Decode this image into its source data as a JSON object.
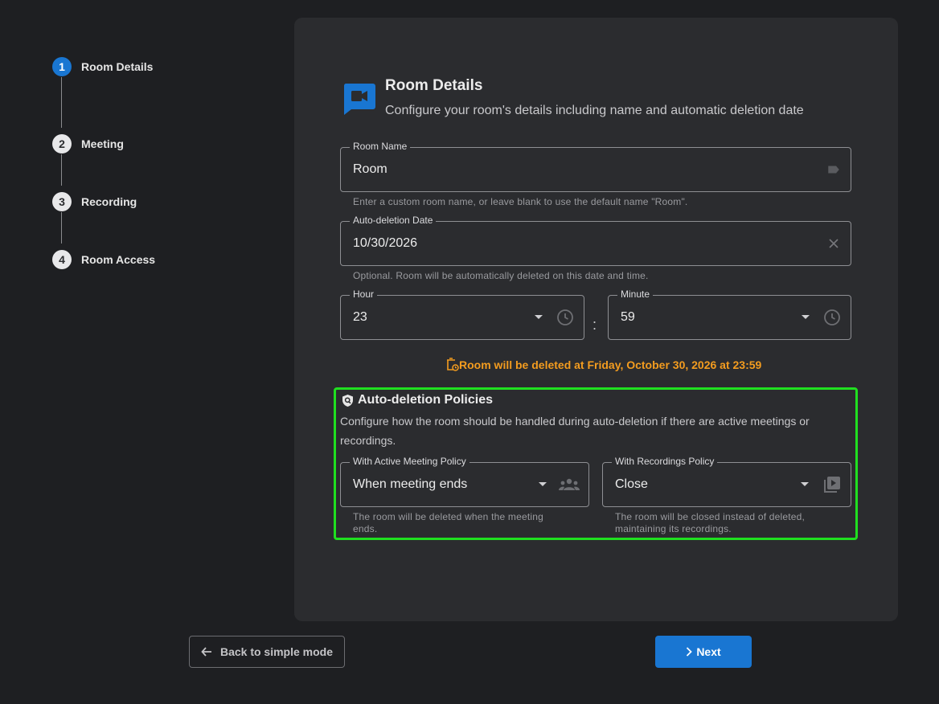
{
  "stepper": {
    "steps": [
      {
        "number": "1",
        "label": "Room Details"
      },
      {
        "number": "2",
        "label": "Meeting"
      },
      {
        "number": "3",
        "label": "Recording"
      },
      {
        "number": "4",
        "label": "Room Access"
      }
    ]
  },
  "header": {
    "icon": "videocam-chat-icon",
    "title": "Room Details",
    "subtitle": "Configure your room's details including name and automatic deletion date"
  },
  "room_name": {
    "label": "Room Name",
    "value": "Room",
    "icon": "label-tag-icon",
    "hint": "Enter a custom room name, or leave blank to use the default name \"Room\"."
  },
  "deletion_date": {
    "label": "Auto-deletion Date",
    "value": "10/30/2026",
    "icon": "clear-icon",
    "hint": "Optional. Room will be automatically deleted on this date and time."
  },
  "hour": {
    "label": "Hour",
    "value": "23",
    "icon": "clock-icon"
  },
  "minute": {
    "label": "Minute",
    "value": "59",
    "icon": "clock-icon"
  },
  "time_separator": ":",
  "warning": {
    "text": "Room will be deleted at Friday, October 30, 2026 at 23:59",
    "color": "#f39c1f",
    "icon": "delete-clock-icon"
  },
  "policies": {
    "title": "Auto-deletion Policies",
    "icon": "shield-search-icon",
    "description": "Configure how the room should be handled during auto-deletion if there are active meetings or recordings.",
    "meeting_policy": {
      "label": "With Active Meeting Policy",
      "value": "When meeting ends",
      "icon": "group-icon",
      "hint": "The room will be deleted when the meeting ends."
    },
    "recordings_policy": {
      "label": "With Recordings Policy",
      "value": "Close",
      "icon": "video-library-icon",
      "hint": "The room will be closed instead of deleted, maintaining its recordings."
    },
    "highlight_color": "#20e020"
  },
  "footer": {
    "back_label": "Back to simple mode",
    "next_label": "Next"
  },
  "colors": {
    "accent": "#1976d2",
    "background": "#1e1f22",
    "card": "#2b2c2f"
  }
}
